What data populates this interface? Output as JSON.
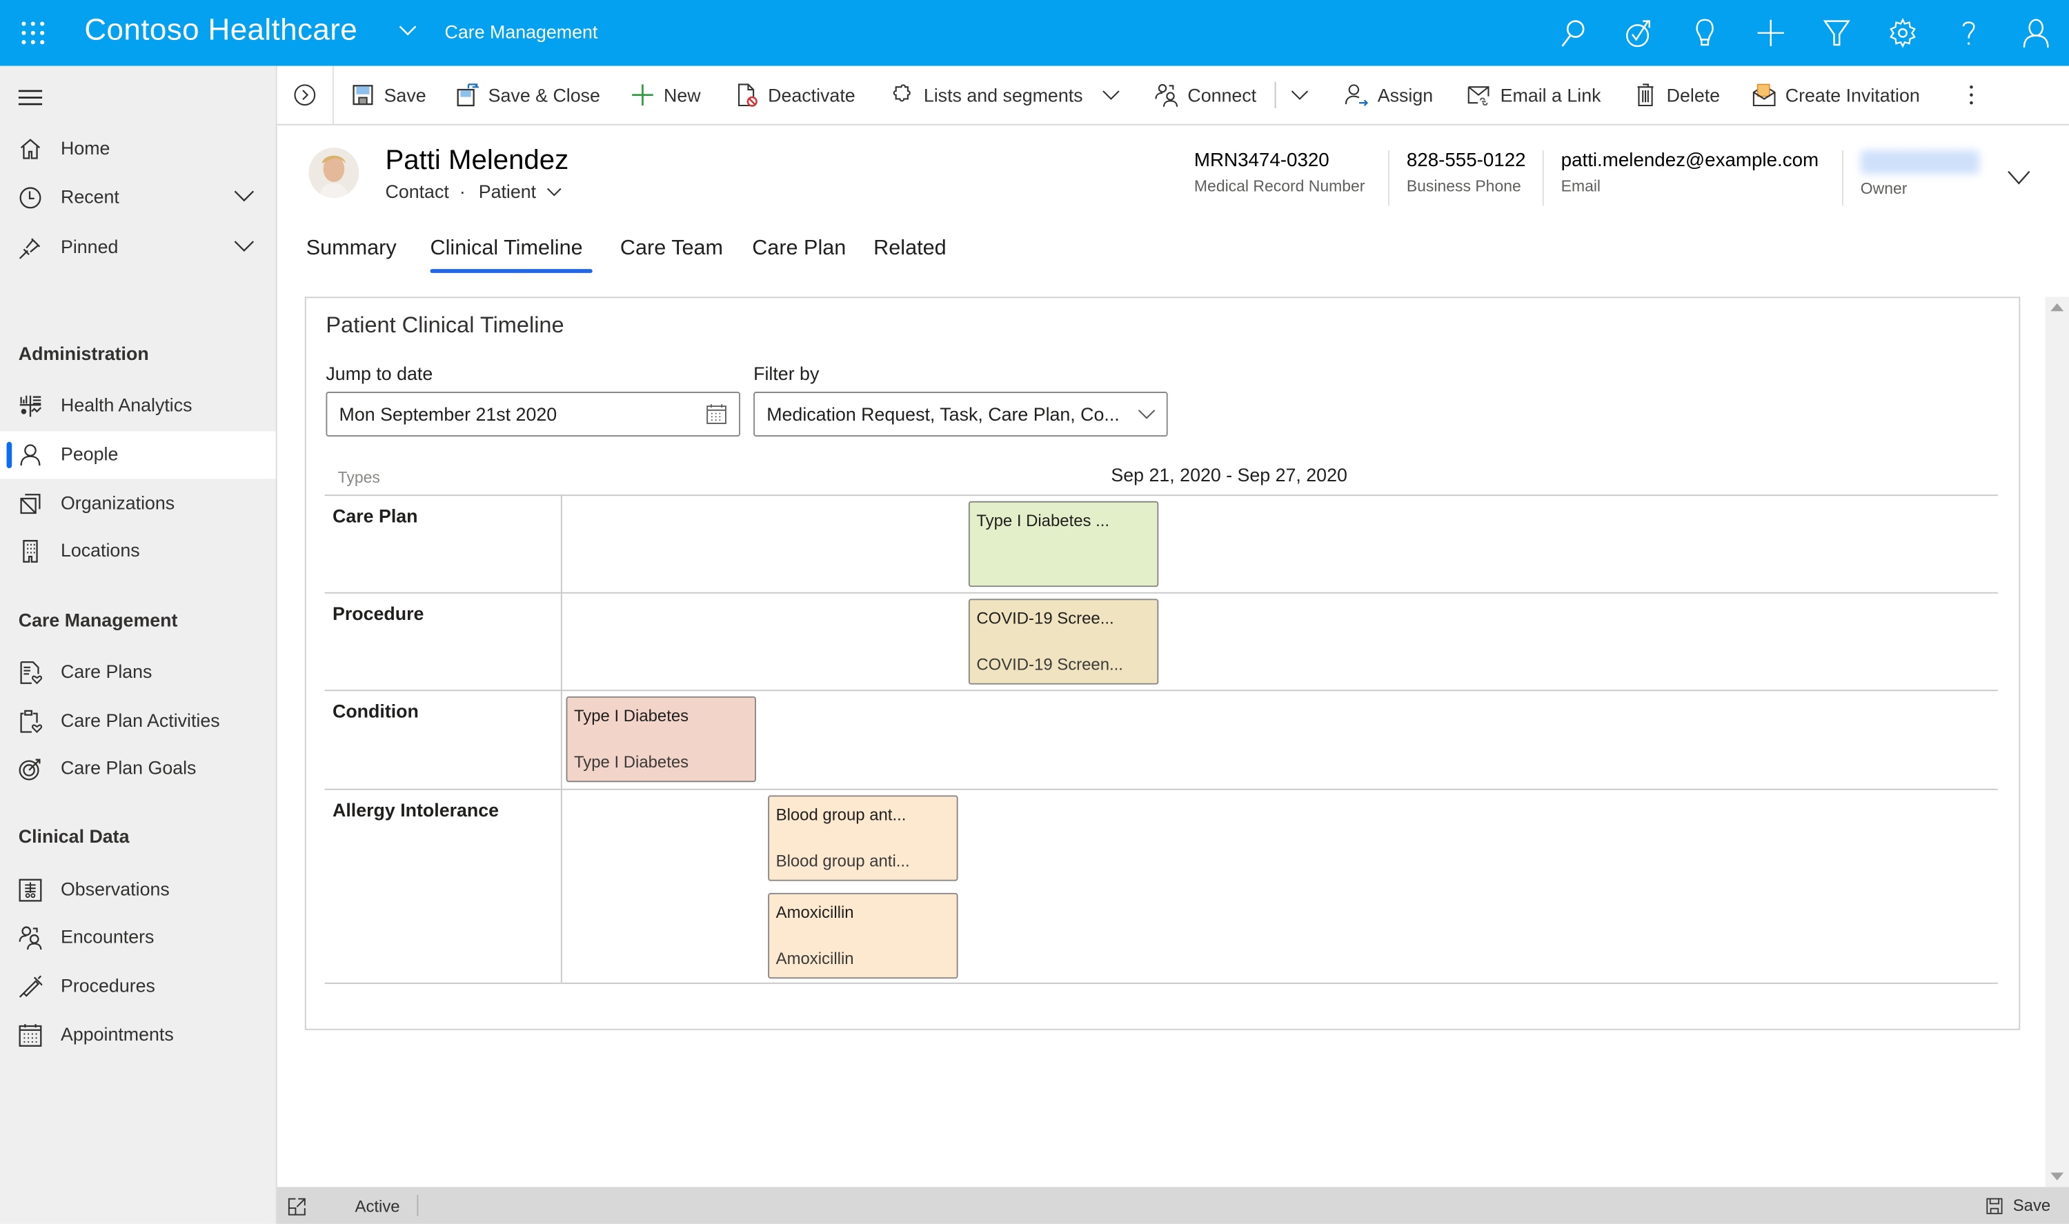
{
  "topbar": {
    "app_title": "Contoso Healthcare",
    "area": "Care Management",
    "icons": [
      "search-icon",
      "task-check-icon",
      "lightbulb-icon",
      "plus-icon",
      "filter-icon",
      "gear-icon",
      "help-icon",
      "user-icon"
    ]
  },
  "sidebar": {
    "top_items": [
      {
        "label": "Home",
        "icon": "home-icon"
      },
      {
        "label": "Recent",
        "icon": "clock-icon",
        "expandable": true
      },
      {
        "label": "Pinned",
        "icon": "pin-icon",
        "expandable": true
      }
    ],
    "groups": [
      {
        "title": "Administration",
        "items": [
          {
            "label": "Health Analytics",
            "icon": "analytics-icon"
          },
          {
            "label": "People",
            "icon": "person-icon",
            "active": true
          },
          {
            "label": "Organizations",
            "icon": "organization-icon"
          },
          {
            "label": "Locations",
            "icon": "building-icon"
          }
        ]
      },
      {
        "title": "Care Management",
        "items": [
          {
            "label": "Care Plans",
            "icon": "care-plan-icon"
          },
          {
            "label": "Care Plan Activities",
            "icon": "clipboard-heart-icon"
          },
          {
            "label": "Care Plan Goals",
            "icon": "target-icon"
          }
        ]
      },
      {
        "title": "Clinical Data",
        "items": [
          {
            "label": "Observations",
            "icon": "observation-icon"
          },
          {
            "label": "Encounters",
            "icon": "people-icon"
          },
          {
            "label": "Procedures",
            "icon": "syringe-icon"
          },
          {
            "label": "Appointments",
            "icon": "calendar-icon"
          }
        ]
      }
    ]
  },
  "commandbar": {
    "save": "Save",
    "save_close": "Save & Close",
    "new": "New",
    "deactivate": "Deactivate",
    "lists_segments": "Lists and segments",
    "connect": "Connect",
    "assign": "Assign",
    "email_link": "Email a Link",
    "delete": "Delete",
    "create_invitation": "Create Invitation"
  },
  "record": {
    "name": "Patti Melendez",
    "entity": "Contact",
    "form": "Patient",
    "fields": [
      {
        "value": "MRN3474-0320",
        "label": "Medical Record Number"
      },
      {
        "value": "828-555-0122",
        "label": "Business Phone"
      },
      {
        "value": "patti.melendez@example.com",
        "label": "Email"
      },
      {
        "value": "",
        "label": "Owner",
        "blurred": true
      }
    ]
  },
  "tabs": [
    {
      "label": "Summary"
    },
    {
      "label": "Clinical Timeline",
      "active": true
    },
    {
      "label": "Care Team"
    },
    {
      "label": "Care Plan"
    },
    {
      "label": "Related"
    }
  ],
  "timeline": {
    "title": "Patient Clinical Timeline",
    "jump_label": "Jump to date",
    "jump_value": "Mon September 21st 2020",
    "filter_label": "Filter by",
    "filter_value": "Medication Request, Task, Care Plan, Co...",
    "types_header": "Types",
    "range": "Sep 21, 2020 - Sep 27, 2020",
    "rows": [
      {
        "type": "Care Plan",
        "events": [
          {
            "title": "Type I Diabetes ...",
            "subtitle": "",
            "color": "#e2efc9"
          }
        ]
      },
      {
        "type": "Procedure",
        "events": [
          {
            "title": "COVID-19 Scree...",
            "subtitle": "COVID-19 Screen...",
            "color": "#f0e4c0"
          }
        ]
      },
      {
        "type": "Condition",
        "events": [
          {
            "title": "Type I Diabetes",
            "subtitle": "Type I Diabetes",
            "color": "#f2d5c8"
          }
        ]
      },
      {
        "type": "Allergy Intolerance",
        "events": [
          {
            "title": "Blood group ant...",
            "subtitle": "Blood group anti...",
            "color": "#fde9d0"
          },
          {
            "title": "Amoxicillin",
            "subtitle": "Amoxicillin",
            "color": "#fde9d0"
          }
        ]
      }
    ]
  },
  "statusbar": {
    "status": "Active",
    "save": "Save"
  },
  "colors": {
    "brand": "#03a1ef",
    "active_tab": "#2266e3",
    "nav_active_bar": "#0b6cf5"
  }
}
